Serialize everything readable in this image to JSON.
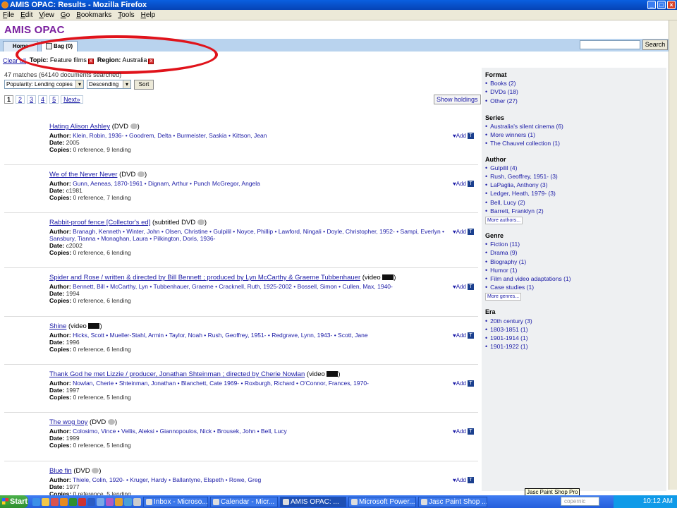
{
  "window": {
    "title": "AMIS OPAC: Results - Mozilla Firefox"
  },
  "menu": [
    "File",
    "Edit",
    "View",
    "Go",
    "Bookmarks",
    "Tools",
    "Help"
  ],
  "app": {
    "title": "AMIS OPAC"
  },
  "tabs": {
    "home": "Home",
    "bag": "Bag (0)"
  },
  "search": {
    "button": "Search",
    "value": ""
  },
  "filters": {
    "clear": "Clear all",
    "topic_label": "Topic:",
    "topic_value": "Feature films",
    "region_label": "Region:",
    "region_value": "Australia"
  },
  "results_info": "47 matches (64140 documents searched)",
  "sort": {
    "field": "Popularity: Lending copies",
    "order": "Descending",
    "button": "Sort"
  },
  "pager": {
    "pages": [
      "1",
      "2",
      "3",
      "4",
      "5"
    ],
    "next": "Next»"
  },
  "show_holdings": "Show holdings",
  "add_label": "♥Add",
  "t_icon": "T",
  "labels": {
    "author": "Author:",
    "date": "Date:",
    "copies": "Copies:"
  },
  "results": [
    {
      "title": "Hating Alison Ashley",
      "format": "(DVD",
      "author": "Klein, Robin, 1936- • Goodrem, Delta • Burmeister, Saskia • Kittson, Jean",
      "date": "2005",
      "copies": "0 reference, 9 lending",
      "icon": "disc"
    },
    {
      "title": "We of the Never Never",
      "format": "(DVD",
      "author": "Gunn, Aeneas, 1870-1961 • Dignam, Arthur • Punch McGregor, Angela",
      "date": "c1981",
      "copies": "0 reference, 7 lending",
      "icon": "disc"
    },
    {
      "title": "Rabbit-proof fence [Collector's ed]",
      "format": "(subtitled DVD",
      "author": "Branagh, Kenneth • Winter, John • Olsen, Christine • Gulpilil • Noyce, Phillip • Lawford, Ningali • Doyle, Christopher, 1952- • Sampi, Everlyn • Sansbury, Tianna • Monaghan, Laura • Pilkington, Doris, 1936-",
      "date": "c2002",
      "copies": "0 reference, 6 lending",
      "icon": "disc"
    },
    {
      "title": "Spider and Rose / written & directed by Bill Bennett ; produced by Lyn McCarthy & Graeme Tubbenhauer",
      "format": "(video",
      "author": "Bennett, Bill • McCarthy, Lyn • Tubbenhauer, Graeme • Cracknell, Ruth, 1925-2002 • Bossell, Simon • Cullen, Max, 1940-",
      "date": "1994",
      "copies": "0 reference, 6 lending",
      "icon": "film"
    },
    {
      "title": "Shine",
      "format": "(video",
      "author": "Hicks, Scott • Mueller-Stahl, Armin • Taylor, Noah • Rush, Geoffrey, 1951- • Redgrave, Lynn, 1943- • Scott, Jane",
      "date": "1996",
      "copies": "0 reference, 6 lending",
      "icon": "film"
    },
    {
      "title": "Thank God he met Lizzie / producer, Jonathan Shteinman ; directed by Cherie Nowlan",
      "format": "(video",
      "author": "Nowlan, Cherie • Shteinman, Jonathan • Blanchett, Cate 1969- • Roxburgh, Richard • O'Connor, Frances, 1970-",
      "date": "1997",
      "copies": "0 reference, 5 lending",
      "icon": "film"
    },
    {
      "title": "The wog boy",
      "format": "(DVD",
      "author": "Colosimo, Vince • Vellis, Aleksi • Giannopoulos, Nick • Brousek, John • Bell, Lucy",
      "date": "1999",
      "copies": "0 reference, 5 lending",
      "icon": "disc"
    },
    {
      "title": "Blue fin",
      "format": "(DVD",
      "author": "Thiele, Colin, 1920- • Kruger, Hardy • Ballantyne, Elspeth • Rowe, Greg",
      "date": "1977",
      "copies": "0 reference, 5 lending",
      "icon": "disc"
    }
  ],
  "facets": {
    "format": {
      "title": "Format",
      "items": [
        "Books (2)",
        "DVDs (18)",
        "Other (27)"
      ]
    },
    "series": {
      "title": "Series",
      "items": [
        "Australia's silent cinema (6)",
        "More winners (1)",
        "The Chauvel collection (1)"
      ]
    },
    "author": {
      "title": "Author",
      "items": [
        "Gulpilil (4)",
        "Rush, Geoffrey, 1951- (3)",
        "LaPaglia, Anthony (3)",
        "Ledger, Heath, 1979- (3)",
        "Bell, Lucy (2)",
        "Barrett, Franklyn (2)"
      ],
      "more": "More authors..."
    },
    "genre": {
      "title": "Genre",
      "items": [
        "Fiction (11)",
        "Drama (9)",
        "Biography (1)",
        "Humor (1)",
        "Film and video adaptations (1)",
        "Case studies (1)"
      ],
      "more": "More genres..."
    },
    "era": {
      "title": "Era",
      "items": [
        "20th century (3)",
        "1803-1851 (1)",
        "1901-1914 (1)",
        "1901-1922 (1)"
      ]
    }
  },
  "taskbar": {
    "start": "Start",
    "buttons": [
      "Inbox - Microso...",
      "Calendar - Micr...",
      "AMIS OPAC: ...",
      "Microsoft Power...",
      "Jasc Paint Shop ..."
    ],
    "search_placeholder": "copernic",
    "clock": "10:12 AM",
    "tooltip": "Jasc Paint Shop Pro"
  },
  "colors": {
    "accent": "#7a1f9e",
    "link": "#1a1aa6",
    "annotation": "#e0131b",
    "nav": "#b9d3ee"
  }
}
